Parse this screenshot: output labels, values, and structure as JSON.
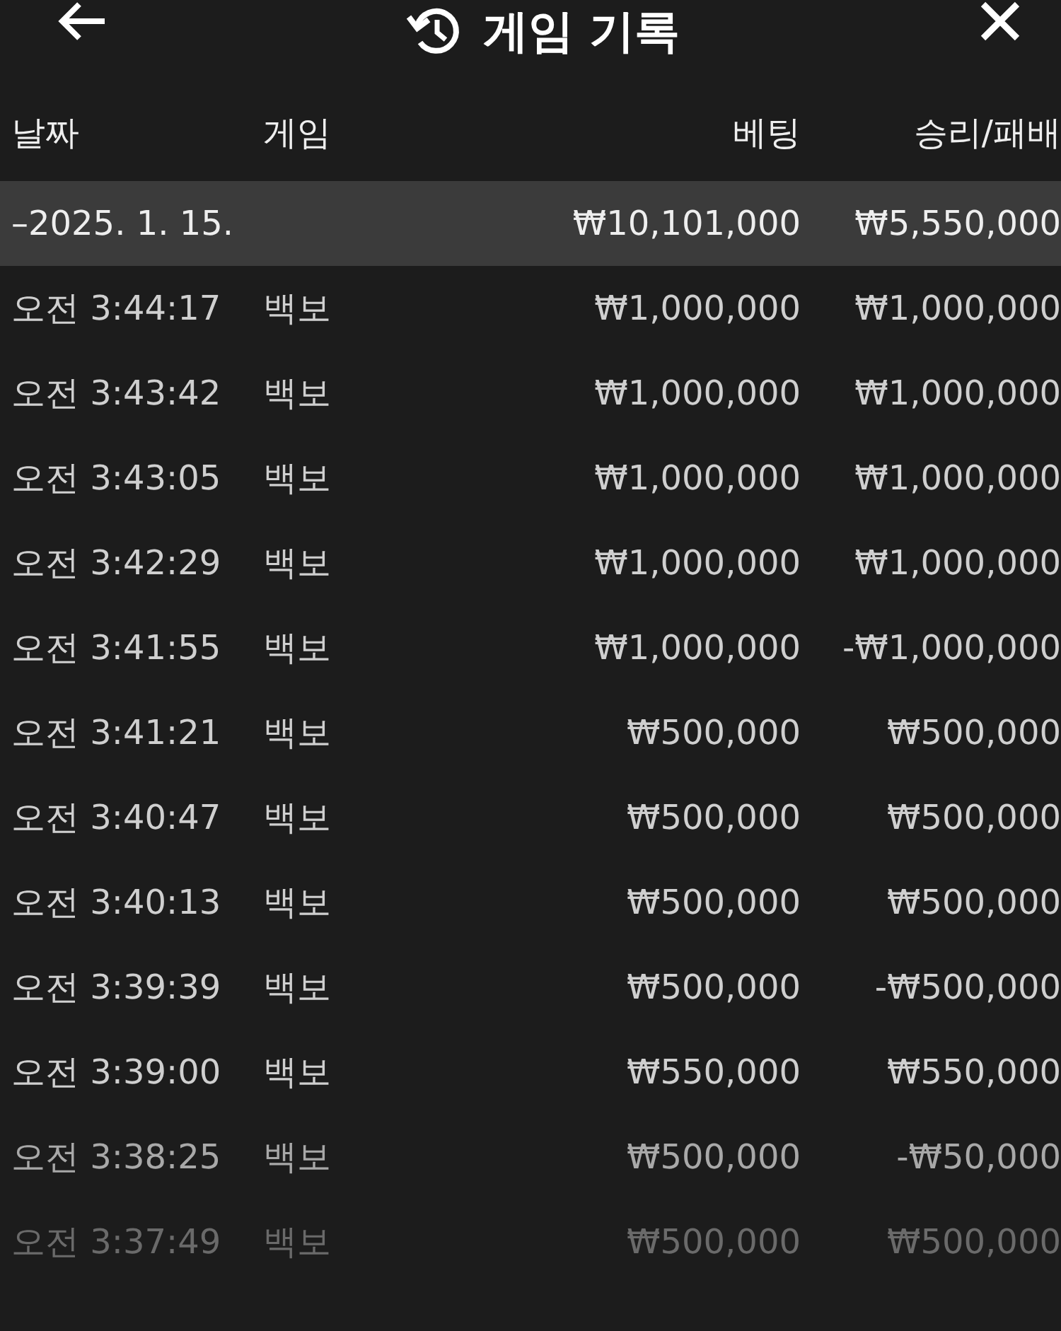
{
  "header": {
    "title": "게임 기록"
  },
  "table": {
    "columns": [
      "날짜",
      "게임",
      "베팅",
      "승리/패배"
    ],
    "summary": {
      "date": "–2025. 1. 15.",
      "bet": "₩10,101,000",
      "result": "₩5,550,000"
    },
    "rows": [
      {
        "time": "오전 3:44:17",
        "game": "백보",
        "bet": "₩1,000,000",
        "result": "₩1,000,000"
      },
      {
        "time": "오전 3:43:42",
        "game": "백보",
        "bet": "₩1,000,000",
        "result": "₩1,000,000"
      },
      {
        "time": "오전 3:43:05",
        "game": "백보",
        "bet": "₩1,000,000",
        "result": "₩1,000,000"
      },
      {
        "time": "오전 3:42:29",
        "game": "백보",
        "bet": "₩1,000,000",
        "result": "₩1,000,000"
      },
      {
        "time": "오전 3:41:55",
        "game": "백보",
        "bet": "₩1,000,000",
        "result": "-₩1,000,000"
      },
      {
        "time": "오전 3:41:21",
        "game": "백보",
        "bet": "₩500,000",
        "result": "₩500,000"
      },
      {
        "time": "오전 3:40:47",
        "game": "백보",
        "bet": "₩500,000",
        "result": "₩500,000"
      },
      {
        "time": "오전 3:40:13",
        "game": "백보",
        "bet": "₩500,000",
        "result": "₩500,000"
      },
      {
        "time": "오전 3:39:39",
        "game": "백보",
        "bet": "₩500,000",
        "result": "-₩500,000"
      },
      {
        "time": "오전 3:39:00",
        "game": "백보",
        "bet": "₩550,000",
        "result": "₩550,000"
      },
      {
        "time": "오전 3:38:25",
        "game": "백보",
        "bet": "₩500,000",
        "result": "-₩50,000"
      },
      {
        "time": "오전 3:37:49",
        "game": "백보",
        "bet": "₩500,000",
        "result": "₩500,000"
      }
    ]
  }
}
